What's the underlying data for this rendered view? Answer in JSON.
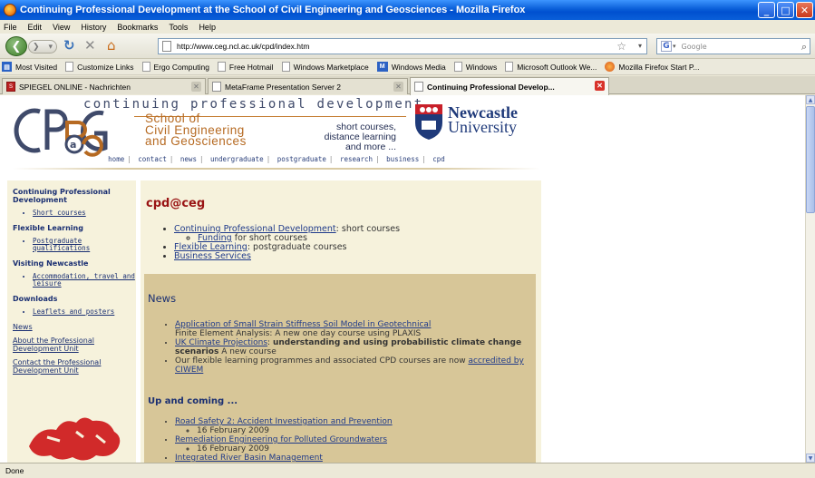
{
  "window": {
    "title": "Continuing Professional Development at the School of Civil Engineering and Geosciences - Mozilla Firefox",
    "min": "_",
    "max": "□",
    "close": "✕"
  },
  "menu": [
    "File",
    "Edit",
    "View",
    "History",
    "Bookmarks",
    "Tools",
    "Help"
  ],
  "navbar": {
    "url": "http://www.ceg.ncl.ac.uk/cpd/index.htm",
    "search_placeholder": "Google"
  },
  "bookmarks": [
    {
      "label": "Most Visited",
      "icon": "page-icon"
    },
    {
      "label": "Customize Links",
      "icon": "page-icon"
    },
    {
      "label": "Ergo Computing",
      "icon": "page-icon"
    },
    {
      "label": "Free Hotmail",
      "icon": "page-icon"
    },
    {
      "label": "Windows Marketplace",
      "icon": "page-icon"
    },
    {
      "label": "Windows Media",
      "icon": "windows-media-icon"
    },
    {
      "label": "Windows",
      "icon": "page-icon"
    },
    {
      "label": "Microsoft Outlook We...",
      "icon": "page-icon"
    },
    {
      "label": "Mozilla Firefox Start P...",
      "icon": "firefox-icon"
    }
  ],
  "tabs": [
    {
      "label": "SPIEGEL ONLINE - Nachrichten"
    },
    {
      "label": "MetaFrame Presentation Server 2"
    },
    {
      "label": "Continuing Professional Develop..."
    }
  ],
  "page": {
    "tagline": "continuing professional development",
    "school": [
      "School of",
      "Civil Engineering",
      "and Geosciences"
    ],
    "tag_right": [
      "short courses,",
      "distance learning",
      "and more ..."
    ],
    "university": [
      "Newcastle",
      "University"
    ],
    "nav": [
      "home",
      "contact",
      "news",
      "undergraduate",
      "postgraduate",
      "research",
      "business",
      "cpd"
    ],
    "sidebar": {
      "cpd_head": "Continuing Professional Development",
      "short_courses": "Short courses",
      "flex_head": "Flexible Learning",
      "postgrad": "Postgraduate qualifications",
      "visiting_head": "Visiting Newcastle",
      "accommodation": "Accommodation, travel and leisure",
      "downloads_head": "Downloads",
      "leaflets": "Leaflets and posters",
      "news": "News",
      "about": "About the Professional Development Unit",
      "contact": "Contact the Professional Development Unit"
    },
    "main": {
      "title": "cpd@ceg",
      "cpd_link": "Continuing Professional Development",
      "cpd_rest": ": short courses",
      "funding_link": "Funding",
      "funding_rest": " for short courses",
      "flex_link": "Flexible Learning",
      "flex_rest": ": postgraduate courses",
      "business_link": "Business Services"
    },
    "news": {
      "title": "News",
      "item1_link": "Application of Small Strain Stiffness Soil Model in Geotechnical",
      "item1_rest": "Finite Element Analysis: A new one day course using PLAXIS",
      "item2_link": "UK Climate Projections",
      "item2_bold": "understanding and using probabilistic climate change scenarios",
      "item2_rest": " A new course",
      "item3_text": "Our flexible learning programmes and associated CPD courses are now ",
      "item3_link": "accredited by CIWEM"
    },
    "upcoming": {
      "title": "Up and coming ...",
      "item1": "Road Safety 2: Accident Investigation and Prevention",
      "item1_date": "16 February 2009",
      "item2": "Remediation Engineering for Polluted Groundwaters",
      "item2_date": "16 February 2009",
      "item3": "Integrated River Basin Management"
    }
  },
  "status": "Done"
}
